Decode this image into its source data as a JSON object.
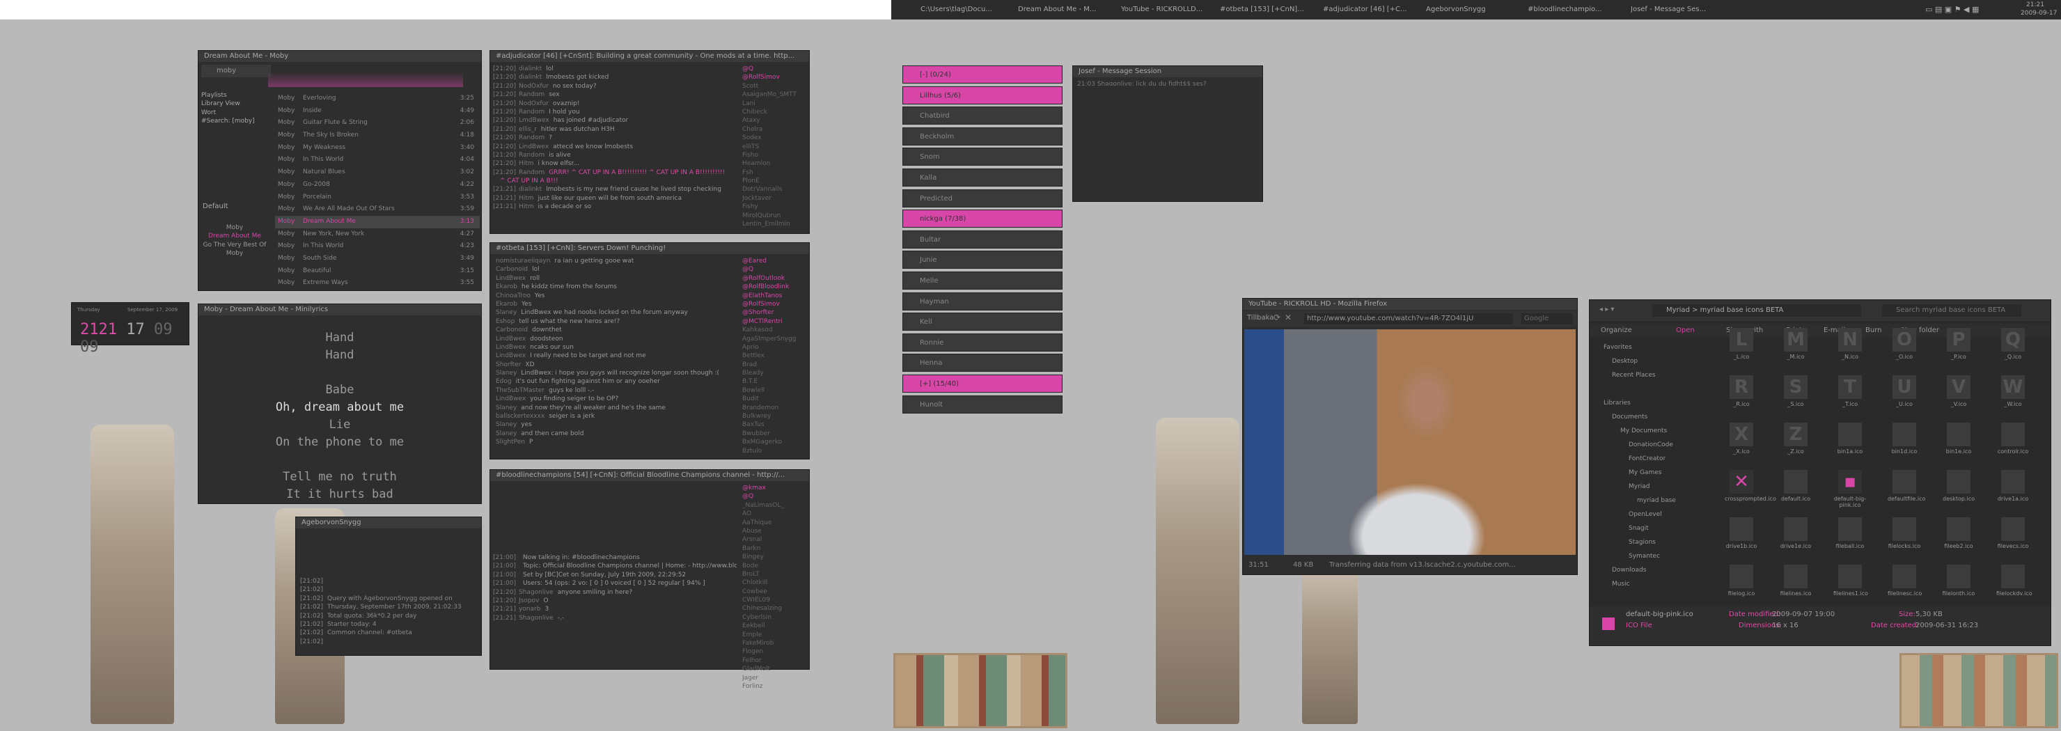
{
  "left_top_bar": {
    "title": ""
  },
  "taskbar": {
    "items": [
      {
        "label": "C:\\Users\\tlag\\Docu..."
      },
      {
        "label": "Dream About Me - M..."
      },
      {
        "label": "YouTube - RICKROLLD..."
      },
      {
        "label": "#otbeta [153] [+CnN]..."
      },
      {
        "label": "#adjudicator [46] [+C..."
      },
      {
        "label": "AgeborvonSnygg"
      },
      {
        "label": "#bloodlinechampio..."
      },
      {
        "label": "Josef - Message Ses..."
      }
    ],
    "clock": "21:21",
    "date": "2009-09-17"
  },
  "player": {
    "title": "Dream About Me - Moby",
    "search": "moby",
    "sources": [
      "Playlists",
      "Library View",
      "Wort",
      "#Search: [moby]"
    ],
    "section": "Default",
    "album_info": [
      "Moby",
      "Dream About Me",
      "Go The Very Best Of",
      "Moby"
    ],
    "tracks": [
      {
        "artist": "Moby",
        "title": "Everloving",
        "len": "3:25"
      },
      {
        "artist": "Moby",
        "title": "Inside",
        "len": "4:49"
      },
      {
        "artist": "Moby",
        "title": "Guitar Flute & String",
        "len": "2:06"
      },
      {
        "artist": "Moby",
        "title": "The Sky Is Broken",
        "len": "4:18"
      },
      {
        "artist": "Moby",
        "title": "My Weakness",
        "len": "3:40"
      },
      {
        "artist": "Moby",
        "title": "In This World",
        "len": "4:04"
      },
      {
        "artist": "Moby",
        "title": "Natural Blues",
        "len": "3:02"
      },
      {
        "artist": "Moby",
        "title": "Go-2008",
        "len": "4:22"
      },
      {
        "artist": "Moby",
        "title": "Porcelain",
        "len": "3:53"
      },
      {
        "artist": "Moby",
        "title": "We Are All Made Out Of Stars",
        "len": "3:59"
      },
      {
        "artist": "Moby",
        "title": "Dream About Me",
        "len": "3:13"
      },
      {
        "artist": "Moby",
        "title": "New York, New York",
        "len": "4:27"
      },
      {
        "artist": "Moby",
        "title": "In This World",
        "len": "4:23"
      },
      {
        "artist": "Moby",
        "title": "South Side",
        "len": "3:49"
      },
      {
        "artist": "Moby",
        "title": "Beautiful",
        "len": "3:15"
      },
      {
        "artist": "Moby",
        "title": "Extreme Ways",
        "len": "3:55"
      }
    ]
  },
  "clockwidget": {
    "label": "Thursday",
    "date": "September 17, 2009",
    "h": "2121",
    "m": "17",
    "s": "09",
    "f": "09"
  },
  "lyrics": {
    "title": "Moby - Dream About Me - Minilyrics",
    "lines": [
      "Hand",
      "Hand",
      "",
      "Babe",
      "Oh, dream about me",
      "Lie",
      "On the phone to me",
      "",
      "Tell me no truth",
      "It it hurts bad"
    ]
  },
  "irc1": {
    "title": "#adjudicator [46] [+CnSnt]: Building a great community - One mods at a time. http...",
    "lines": [
      [
        "[21:20]",
        "dialinkt",
        "lol"
      ],
      [
        "[21:20]",
        "dialinkt",
        "lmobests got kicked"
      ],
      [
        "[21:20]",
        "NodOxfur",
        "no sex today?"
      ],
      [
        "[21:20]",
        "Random",
        "sex"
      ],
      [
        "[21:20]",
        "NodOxfur",
        "ovaznip!"
      ],
      [
        "[21:20]",
        "Random",
        "I hold you"
      ],
      [
        "[21:20]",
        "LmdBwex",
        "has joined #adjudicator"
      ],
      [
        "[21:20]",
        "ellis_r",
        "hitler was dutchan H3H"
      ],
      [
        "[21:20]",
        "Random",
        "?"
      ],
      [
        "[21:20]",
        "LindBwex",
        "attecd we know lmobests"
      ],
      [
        "[21:20]",
        "Random",
        "is alive"
      ],
      [
        "[21:20]",
        "Hitm",
        "i know elfsr..."
      ],
      [
        "[21:20]",
        "Random",
        "GRRR! ^ CAT UP IN A B!!!!!!!!!! ^ CAT UP IN A B!!!!!!!!!!"
      ],
      [
        "",
        "",
        "^ CAT UP IN A B!!!"
      ],
      [
        "[21:21]",
        "dialinkt",
        "lmobests is my new friend cause he lived stop checking"
      ],
      [
        "[21:21]",
        "Hitm",
        "just like our queen will be from south america"
      ],
      [
        "[21:21]",
        "Hitm",
        "is a decade or so"
      ]
    ],
    "nicks": [
      "@Q",
      "@RolfSimov",
      "Scott",
      "AsaiganMo_SMTT",
      "Lani",
      "Chibeck",
      "Ataxy",
      "Chelra",
      "Sodex",
      "elliTS",
      "Fisho",
      "Heamlon",
      "Fsh",
      "PlonE",
      "DotrVannalls",
      "Jocktaver",
      "Fishy",
      "MirolQubrun",
      "Lentin_Emilmin"
    ]
  },
  "irc2": {
    "title": "#otbeta [153] [+CnN]: Servers Down! Punching!",
    "lines": [
      [
        "",
        "nomisturaeiiqayn",
        "ra ian u getting gooe wat"
      ],
      [
        "",
        "Carbonoid",
        "lol"
      ],
      [
        "",
        "LindBwex",
        "roll"
      ],
      [
        "",
        "Ekarob",
        "he kiddz time from the forums"
      ],
      [
        "",
        "ChinoaTroo",
        "Yes"
      ],
      [
        "",
        "Ekarob",
        "Yes"
      ],
      [
        "",
        "Slaney",
        "LindBwex we had noobs locked on the forum anyway"
      ],
      [
        "",
        "Eshop",
        "tell us what the new heros are!?"
      ],
      [
        "",
        "Carbonoid",
        "downthet"
      ],
      [
        "",
        "LindBwex",
        "doodsteon"
      ],
      [
        "",
        "LindBwex",
        "ncaks our sun"
      ],
      [
        "",
        "LindBwex",
        "I really need to be target and not me"
      ],
      [
        "",
        "Shorfter",
        "XD"
      ],
      [
        "",
        "Slaney",
        "LindBwex: i hope you guys will recognize longar soon though :("
      ],
      [
        "",
        "Edog",
        "it's out fun fighting against him or any ooeher"
      ],
      [
        "",
        "TheSubTMaster",
        "guys ke lolll -.-"
      ],
      [
        "",
        "LindBwex",
        "you finding seiger to be OP?"
      ],
      [
        "",
        "Slaney",
        "and now they're all weaker and he's the same"
      ],
      [
        "",
        "ballsckertexxxx",
        "seiger is a jerk"
      ],
      [
        "",
        "Slaney",
        "yes"
      ],
      [
        "",
        "Slaney",
        "and then came bold"
      ],
      [
        "",
        "SlightPen",
        "P"
      ]
    ],
    "nicks": [
      "@Eared",
      "@Q",
      "@RolfOutlook",
      "@RolfBloodlink",
      "@ElathTanos",
      "@RolfSimov",
      "@Shorfter",
      "@MCTlRentri",
      "Kahkasod",
      "AgaSlmperSnygg",
      "Aprio",
      "Bettlex",
      "Brad",
      "Bleady",
      "B.T.E",
      "Bowlell",
      "Budit",
      "Brandemon",
      "Bulkwrey",
      "BaxTus",
      "Bwubber",
      "BxMGagerko",
      "Bztulo"
    ]
  },
  "irc3": {
    "title": "#bloodlinechampions [54] [+CnN]: Official Bloodline Champions channel - http://...",
    "lines": [
      [
        "[21:00]",
        "",
        "Now talking in: #bloodlinechampions"
      ],
      [
        "[21:00]",
        "",
        "Topic: Official Bloodline Champions channel | Home: - http://www.bloodlinechampions.com/ | Stay to Bloodline Champions? There's a New Start, make a fun forums at http://www.bloodlinechampions.com/Bloodline Forums"
      ],
      [
        "[21:00]",
        "",
        "Set by [BC]Cet on Sunday, July 19th 2009, 22:29:52"
      ],
      [
        "[21:00]",
        "",
        "Users: 54 (ops: 2 vo: [ 0 ] 0 voiced [ 0 ] 52 regular [ 94% ]"
      ],
      [
        "[21:20]",
        "Shagonlive",
        "anyone smiling in here?"
      ],
      [
        "[21:20]",
        "Jsopov",
        "O"
      ],
      [
        "[21:21]",
        "yonarb",
        "3"
      ],
      [
        "[21:21]",
        "Shagonlive",
        "-.-"
      ]
    ],
    "nicks": [
      "@kmax",
      "@Q",
      "_NaLimasOL_",
      "AO",
      "AaThique",
      "Abuse",
      "Arsnal",
      "Barkn",
      "Bingey",
      "Bode",
      "BroLT",
      "Chlotkill",
      "Cowbee",
      "CWIEL09",
      "Chinesalzing",
      "Cyberlsin",
      "Eekbell",
      "Emple",
      "FakeMirob",
      "Flogen",
      "Felhor",
      "GladMolt",
      "Jager",
      "Forlinz"
    ]
  },
  "profile": {
    "title": "AgeborvonSnygg",
    "lines": [
      [
        "[21:02]",
        ""
      ],
      [
        "[21:02]",
        ""
      ],
      [
        "[21:02]",
        "Query with AgeborvonSnygg opened on"
      ],
      [
        "[21:02]",
        "Thursday, September 17th 2009, 21:02:33"
      ],
      [
        "[21:02]",
        "Total quota: 36k*0.2 per day"
      ],
      [
        "[21:02]",
        "Starter today: 4"
      ],
      [
        "[21:02]",
        "Common channel: #otbeta"
      ],
      [
        "[21:02]",
        ""
      ]
    ]
  },
  "contacts": {
    "groups": [
      {
        "label": "[-] (0/24)",
        "pink": true
      },
      {
        "label": "Lillhus (5/6)",
        "pink": true
      },
      {
        "label": "Chatbird",
        "pink": false
      },
      {
        "label": "Beckholm",
        "pink": false
      },
      {
        "label": "Snom",
        "pink": false
      },
      {
        "label": "Kalla",
        "pink": false
      },
      {
        "label": "Predicted",
        "pink": false
      },
      {
        "label": "nickga (7/38)",
        "pink": true
      },
      {
        "label": "Bultar",
        "pink": false
      },
      {
        "label": "Junie",
        "pink": false
      },
      {
        "label": "Melle",
        "pink": false
      },
      {
        "label": "Hayman",
        "pink": false
      },
      {
        "label": "Kell",
        "pink": false
      },
      {
        "label": "Ronnie",
        "pink": false
      },
      {
        "label": "Henna",
        "pink": false
      },
      {
        "label": "[+] (15/40)",
        "pink": true
      },
      {
        "label": "Hunolt",
        "pink": false
      }
    ]
  },
  "msgsession": {
    "title": "Josef - Message Session",
    "line": "21:03 Shagonlive: lick du du fidht$$ ses?"
  },
  "browser": {
    "title": "YouTube - RICKROLL HD - Mozilla Firefox",
    "url": "http://www.youtube.com/watch?v=4R-7ZO4l1jU",
    "search": "Google",
    "back": "Tillbaka",
    "status": "Transferring data from v13.lscache2.c.youtube.com...",
    "time": "31:51",
    "size": "48 KB"
  },
  "explorer": {
    "path": "Myriad > myriad base icons BETA",
    "search": "Search myriad base icons BETA",
    "toolbar": [
      "Organize",
      "Open",
      "Share with",
      "Print",
      "E-mail",
      "Burn",
      "New folder"
    ],
    "tree": [
      {
        "label": "Favorites",
        "lvl": 0
      },
      {
        "label": "Desktop",
        "lvl": 1
      },
      {
        "label": "Recent Places",
        "lvl": 1
      },
      {
        "label": "",
        "lvl": 0
      },
      {
        "label": "Libraries",
        "lvl": 0
      },
      {
        "label": "Documents",
        "lvl": 1
      },
      {
        "label": "My Documents",
        "lvl": 2
      },
      {
        "label": "DonationCode",
        "lvl": 3
      },
      {
        "label": "FontCreator",
        "lvl": 3
      },
      {
        "label": "My Games",
        "lvl": 3
      },
      {
        "label": "Myriad",
        "lvl": 3
      },
      {
        "label": "myriad base",
        "lvl": 4
      },
      {
        "label": "OpenLevel",
        "lvl": 3
      },
      {
        "label": "Snagit",
        "lvl": 3
      },
      {
        "label": "Stagions",
        "lvl": 3
      },
      {
        "label": "Symantec",
        "lvl": 3
      },
      {
        "label": "Downloads",
        "lvl": 1
      },
      {
        "label": "Music",
        "lvl": 1
      }
    ],
    "icons": [
      {
        "g": "L",
        "n": "_L.ico"
      },
      {
        "g": "M",
        "n": "_M.ico"
      },
      {
        "g": "N",
        "n": "_N.ico"
      },
      {
        "g": "O",
        "n": "_O.ico"
      },
      {
        "g": "P",
        "n": "_P.ico"
      },
      {
        "g": "Q",
        "n": "_Q.ico"
      },
      {
        "g": "R",
        "n": "_R.ico"
      },
      {
        "g": "S",
        "n": "_S.ico"
      },
      {
        "g": "T",
        "n": "_T.ico"
      },
      {
        "g": "U",
        "n": "_U.ico"
      },
      {
        "g": "V",
        "n": "_V.ico"
      },
      {
        "g": "W",
        "n": "_W.ico"
      },
      {
        "g": "X",
        "n": "_X.ico"
      },
      {
        "g": "Z",
        "n": "_Z.ico"
      },
      {
        "g": "",
        "n": "bin1a.ico"
      },
      {
        "g": "",
        "n": "bin1d.ico"
      },
      {
        "g": "",
        "n": "bin1e.ico"
      },
      {
        "g": "",
        "n": "controlr.ico"
      },
      {
        "g": "✕",
        "n": "crossprompted.ico"
      },
      {
        "g": "",
        "n": "default.ico"
      },
      {
        "g": "▪",
        "n": "default-big-pink.ico"
      },
      {
        "g": "",
        "n": "defaultfile.ico"
      },
      {
        "g": "",
        "n": "desktop.ico"
      },
      {
        "g": "",
        "n": "drive1a.ico"
      },
      {
        "g": "",
        "n": "drive1b.ico"
      },
      {
        "g": "",
        "n": "drive1e.ico"
      },
      {
        "g": "",
        "n": "fileball.ico"
      },
      {
        "g": "",
        "n": "filelocks.ico"
      },
      {
        "g": "",
        "n": "fileeb2.ico"
      },
      {
        "g": "",
        "n": "filevecs.ico"
      },
      {
        "g": "",
        "n": "filelog.ico"
      },
      {
        "g": "",
        "n": "filelines.ico"
      },
      {
        "g": "",
        "n": "filelines1.ico"
      },
      {
        "g": "",
        "n": "filelinesc.ico"
      },
      {
        "g": "",
        "n": "filelonth.ico"
      },
      {
        "g": "",
        "n": "filelockdv.ico"
      }
    ],
    "selected": {
      "name": "default-big-pink.ico",
      "type": "ICO File",
      "modified_label": "Date modified:",
      "modified": "2009-09-07 19:00",
      "dims_label": "Dimensions:",
      "dims": "16 x 16",
      "size_label": "Size:",
      "size": "5,30 KB",
      "created_label": "Date created:",
      "created": "2009-06-31 16:23"
    }
  },
  "colors": {
    "accent": "#d846a8",
    "panel": "#2e2e2e",
    "desktop": "#b9b9b9"
  }
}
